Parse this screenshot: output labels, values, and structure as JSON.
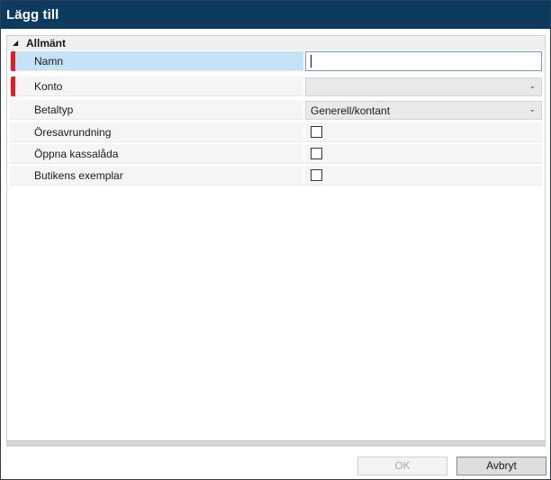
{
  "window": {
    "title": "Lägg till"
  },
  "category": {
    "label": "Allmänt",
    "expanded_icon": "triangle-expanded-icon"
  },
  "properties": [
    {
      "label": "Namn",
      "required": true,
      "editor": "text",
      "value": ""
    },
    {
      "label": "Konto",
      "required": true,
      "editor": "combo",
      "value": ""
    },
    {
      "label": "Betaltyp",
      "required": false,
      "editor": "combo",
      "value": "Generell/kontant"
    },
    {
      "label": "Öresavrundning",
      "required": false,
      "editor": "checkbox",
      "checked": false
    },
    {
      "label": "Öppna kassalåda",
      "required": false,
      "editor": "checkbox",
      "checked": false
    },
    {
      "label": "Butikens exemplar",
      "required": false,
      "editor": "checkbox",
      "checked": false
    }
  ],
  "buttons": {
    "ok": "OK",
    "cancel": "Avbryt"
  },
  "colors": {
    "titlebar": "#0d3a5f",
    "required_marker": "#e51c23",
    "selected_row": "#c5e3f6"
  }
}
